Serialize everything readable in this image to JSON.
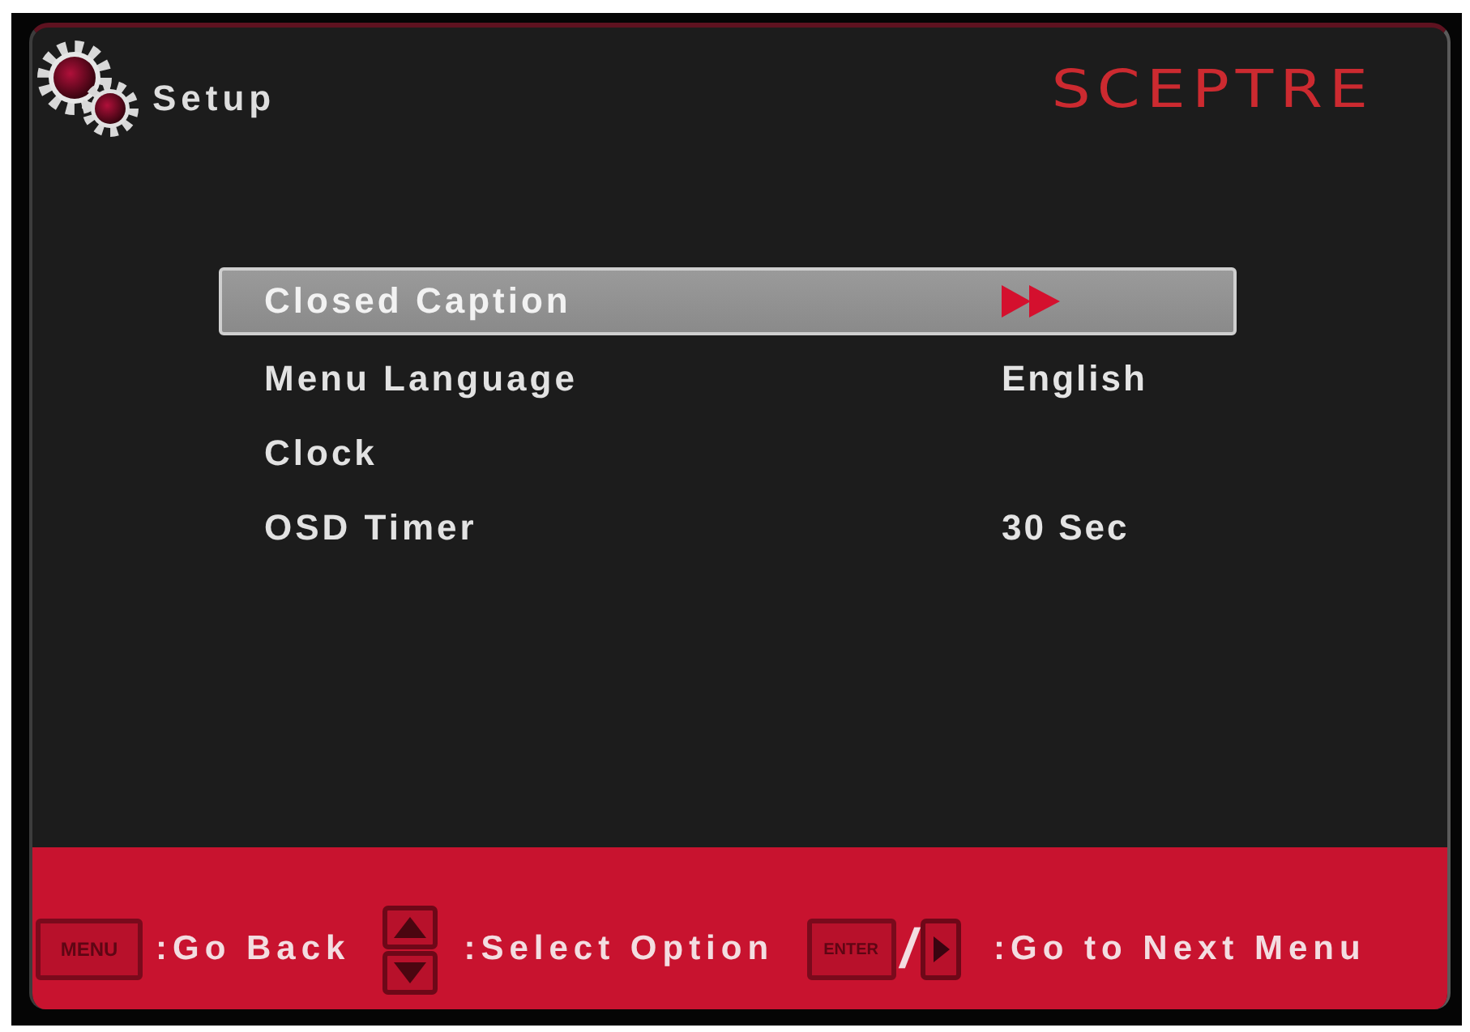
{
  "header": {
    "title": "Setup",
    "logo": "SCEPTRE"
  },
  "menu": [
    {
      "label": "Closed Caption",
      "kind": "submenu",
      "selected": true
    },
    {
      "label": "Menu Language",
      "kind": "setting",
      "value": "English",
      "selected": false
    },
    {
      "label": "Clock",
      "kind": "setting",
      "selected": false
    },
    {
      "label": "OSD Timer",
      "kind": "setting",
      "value": "30 Sec",
      "selected": false
    }
  ],
  "footer": {
    "hints": [
      {
        "keys": [
          {
            "kind": "key",
            "label": "MENU"
          }
        ],
        "action": ":Go Back"
      },
      {
        "keys": [
          {
            "kind": "up-down"
          }
        ],
        "action": ":Select Option"
      },
      {
        "keys": [
          {
            "kind": "key",
            "label": "ENTER"
          },
          {
            "kind": "separator",
            "label": "/"
          },
          {
            "kind": "right"
          }
        ],
        "action": ":Go to Next Menu"
      }
    ]
  }
}
